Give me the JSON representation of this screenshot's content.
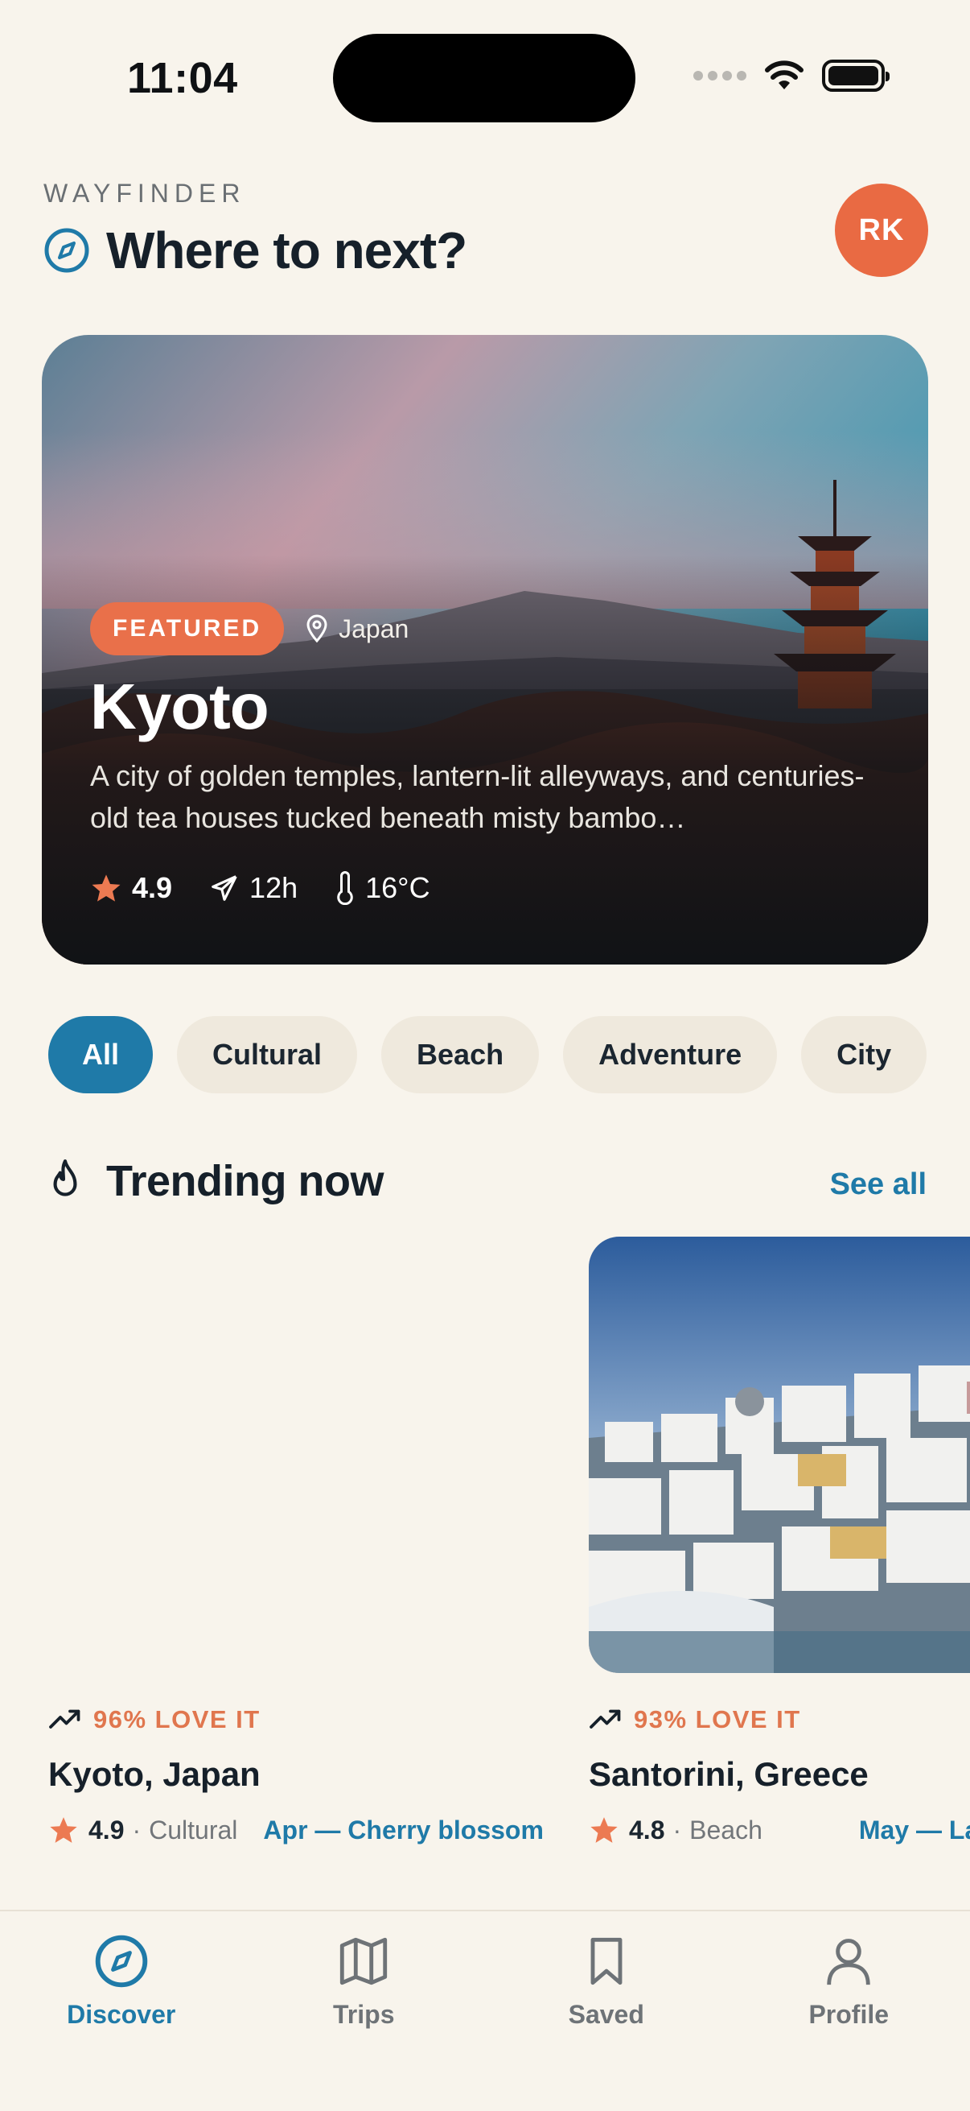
{
  "status_bar": {
    "time": "11:04"
  },
  "header": {
    "brand": "WAYFINDER",
    "title": "Where to next?",
    "avatar_initials": "RK"
  },
  "hero": {
    "badge": "FEATURED",
    "location": "Japan",
    "title": "Kyoto",
    "description": "A city of golden temples, lantern-lit alleyways, and centuries-old tea houses tucked beneath misty bambo…",
    "rating": "4.9",
    "flight_time": "12h",
    "temperature": "16°C"
  },
  "chips": [
    {
      "label": "All",
      "active": true
    },
    {
      "label": "Cultural",
      "active": false
    },
    {
      "label": "Beach",
      "active": false
    },
    {
      "label": "Adventure",
      "active": false
    },
    {
      "label": "City",
      "active": false
    }
  ],
  "trending": {
    "title": "Trending now",
    "see_all": "See all",
    "cards": [
      {
        "love": "96% LOVE IT",
        "title": "Kyoto, Japan",
        "rating": "4.9",
        "category": "Cultural",
        "season": "Apr — Cherry blossom"
      },
      {
        "love": "93% LOVE IT",
        "title": "Santorini, Greece",
        "rating": "4.8",
        "category": "Beach",
        "season": "May — La"
      }
    ]
  },
  "bottom_nav": [
    {
      "label": "Discover",
      "icon": "compass-icon",
      "active": true
    },
    {
      "label": "Trips",
      "icon": "map-icon",
      "active": false
    },
    {
      "label": "Saved",
      "icon": "bookmark-icon",
      "active": false
    },
    {
      "label": "Profile",
      "icon": "user-icon",
      "active": false
    }
  ],
  "colors": {
    "accent": "#1f7aa8",
    "brand_orange": "#e96a43",
    "background": "#f8f4ec"
  }
}
